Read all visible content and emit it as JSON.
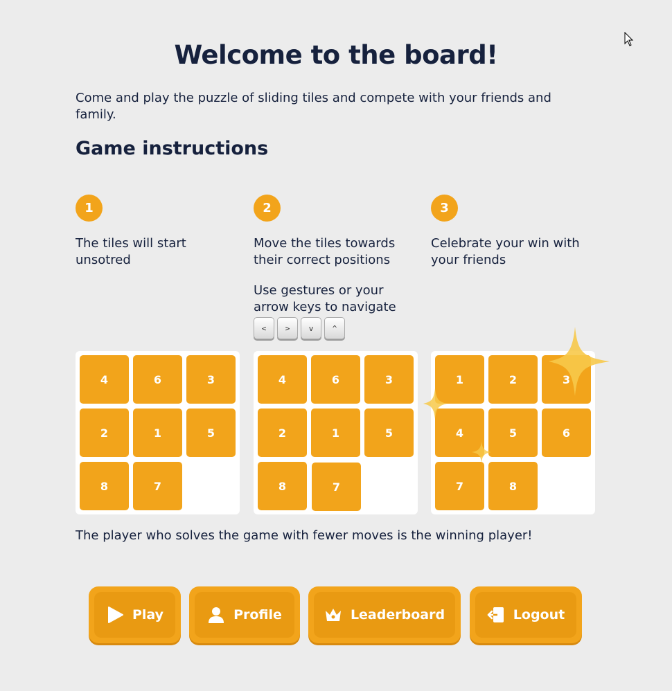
{
  "header": {
    "title": "Welcome to the board!",
    "intro": "Come and play the puzzle of sliding tiles and compete with your friends and family."
  },
  "instructions": {
    "heading": "Game instructions",
    "steps": [
      {
        "number": "1",
        "text": "The tiles will start unsotred"
      },
      {
        "number": "2",
        "text": "Move the tiles towards their correct positions",
        "subtext": "Use gestures or your arrow keys to navigate",
        "keys": [
          "<",
          ">",
          "v",
          "^"
        ]
      },
      {
        "number": "3",
        "text": "Celebrate your win with your friends"
      }
    ]
  },
  "boards": [
    {
      "name": "unsorted",
      "tiles": [
        "4",
        "6",
        "3",
        "2",
        "1",
        "5",
        "8",
        "7",
        ""
      ]
    },
    {
      "name": "moving",
      "tiles": [
        "4",
        "6",
        "3",
        "2",
        "1",
        "5",
        "8",
        "7",
        ""
      ]
    },
    {
      "name": "solved",
      "tiles": [
        "1",
        "2",
        "3",
        "4",
        "5",
        "6",
        "7",
        "8",
        ""
      ]
    }
  ],
  "winner_text": "The player who solves the game with fewer moves is the winning player!",
  "actions": {
    "play": {
      "label": "Play",
      "icon": "play-icon"
    },
    "profile": {
      "label": "Profile",
      "icon": "user-icon"
    },
    "leaderboard": {
      "label": "Leaderboard",
      "icon": "crown-icon"
    },
    "logout": {
      "label": "Logout",
      "icon": "logout-icon"
    }
  },
  "colors": {
    "accent": "#f2a41b",
    "text": "#16213d",
    "background": "#ececec"
  }
}
